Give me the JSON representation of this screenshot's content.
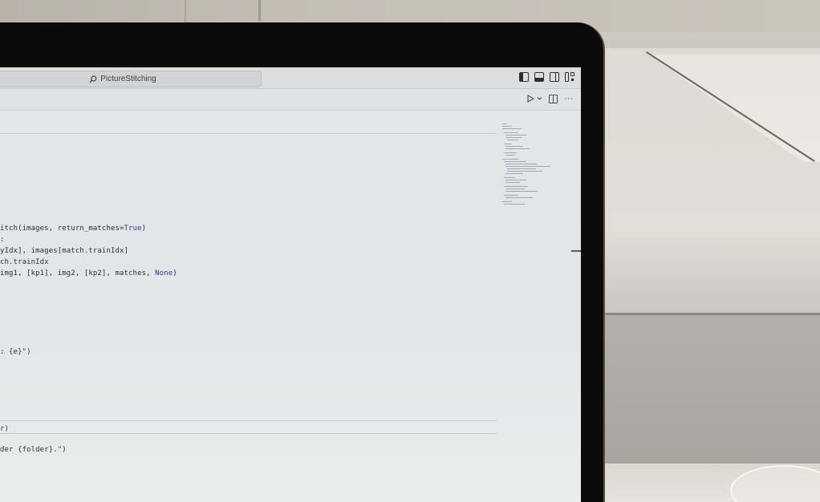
{
  "window": {
    "search_label": "PictureStitching",
    "layout_icons": [
      "toggle-primary-sidebar-icon",
      "toggle-panel-icon",
      "toggle-secondary-sidebar-icon",
      "customize-layout-icon"
    ]
  },
  "editor_toolbar": {
    "run_icon": "play-icon",
    "run_menu_icon": "chevron-down-icon",
    "split_icon": "split-editor-icon",
    "more_label": "···"
  },
  "code": {
    "line_1": {
      "a": "itch(images, return_matches=",
      "kw": "True",
      "b": ")"
    },
    "line_2": ":",
    "line_3": "yIdx], images[match.trainIdx]",
    "line_4": "ch.trainIdx",
    "line_5": {
      "a": "img1, [kp1], img2, [kp2], matches, ",
      "kw": "None",
      "b": ")"
    },
    "line_6": ": {e}\")",
    "line_7": "r)",
    "line_8": "der {folder}.\")"
  },
  "colors": {
    "keyword": "#2a39a8",
    "editor_bg": "#e5e7e8",
    "bezel": "#0b0b0c"
  }
}
